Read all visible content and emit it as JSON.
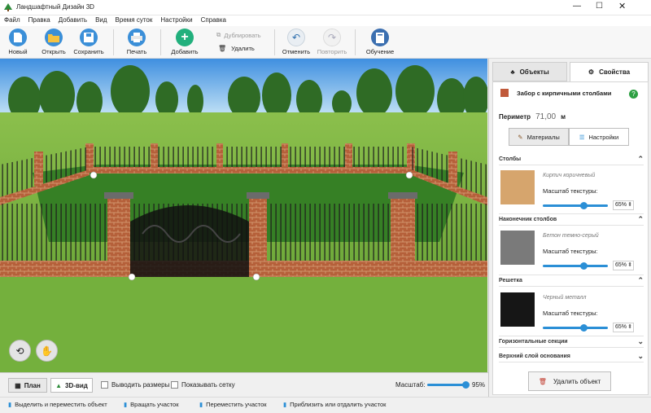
{
  "window": {
    "title": "Ландшафтный Дизайн 3D",
    "controls": [
      "minimize-icon",
      "maximize-icon",
      "close-icon"
    ]
  },
  "menu": [
    "Файл",
    "Правка",
    "Добавить",
    "Вид",
    "Время суток",
    "Настройки",
    "Справка"
  ],
  "toolbar": {
    "new": "Новый",
    "open": "Открыть",
    "save": "Сохранить",
    "print": "Печать",
    "add": "Добавить",
    "duplicate": "Дублировать",
    "delete": "Удалить",
    "undo": "Отменить",
    "redo": "Повторить",
    "learn": "Обучение"
  },
  "panel": {
    "tabs": {
      "objects": "Объекты",
      "properties": "Свойства"
    },
    "object_name": "Забор с кирпичными столбами",
    "perimeter_label": "Периметр",
    "perimeter_value": "71,00",
    "perimeter_unit": "м",
    "sub_tabs": {
      "materials": "Материалы",
      "settings": "Настройки"
    },
    "sections": [
      {
        "title": "Столбы",
        "material": "Кирпич коричневый",
        "scale_label": "Масштаб текстуры:",
        "scale": "65%"
      },
      {
        "title": "Наконечник столбов",
        "material": "Бетон темно-серый",
        "scale_label": "Масштаб текстуры:",
        "scale": "65%"
      },
      {
        "title": "Решетка",
        "material": "Черный металл",
        "scale_label": "Масштаб текстуры:",
        "scale": "65%"
      }
    ],
    "collapsed": [
      "Горизонтальные секции",
      "Верхний слой основания"
    ],
    "delete_button": "Удалить объект",
    "accent": "#2b8fd6"
  },
  "bottombar": {
    "plan": "План",
    "view3d": "3D-вид",
    "show_sizes": "Выводить размеры",
    "show_grid": "Показывать сетку",
    "scale_label": "Масштаб:",
    "scale_value": "95%",
    "scale_fraction": 0.95
  },
  "status": {
    "select": "Выделить и переместить объект",
    "rotate": "Вращать участок",
    "move": "Переместить участок",
    "zoom": "Приблизить или отдалить участок"
  }
}
